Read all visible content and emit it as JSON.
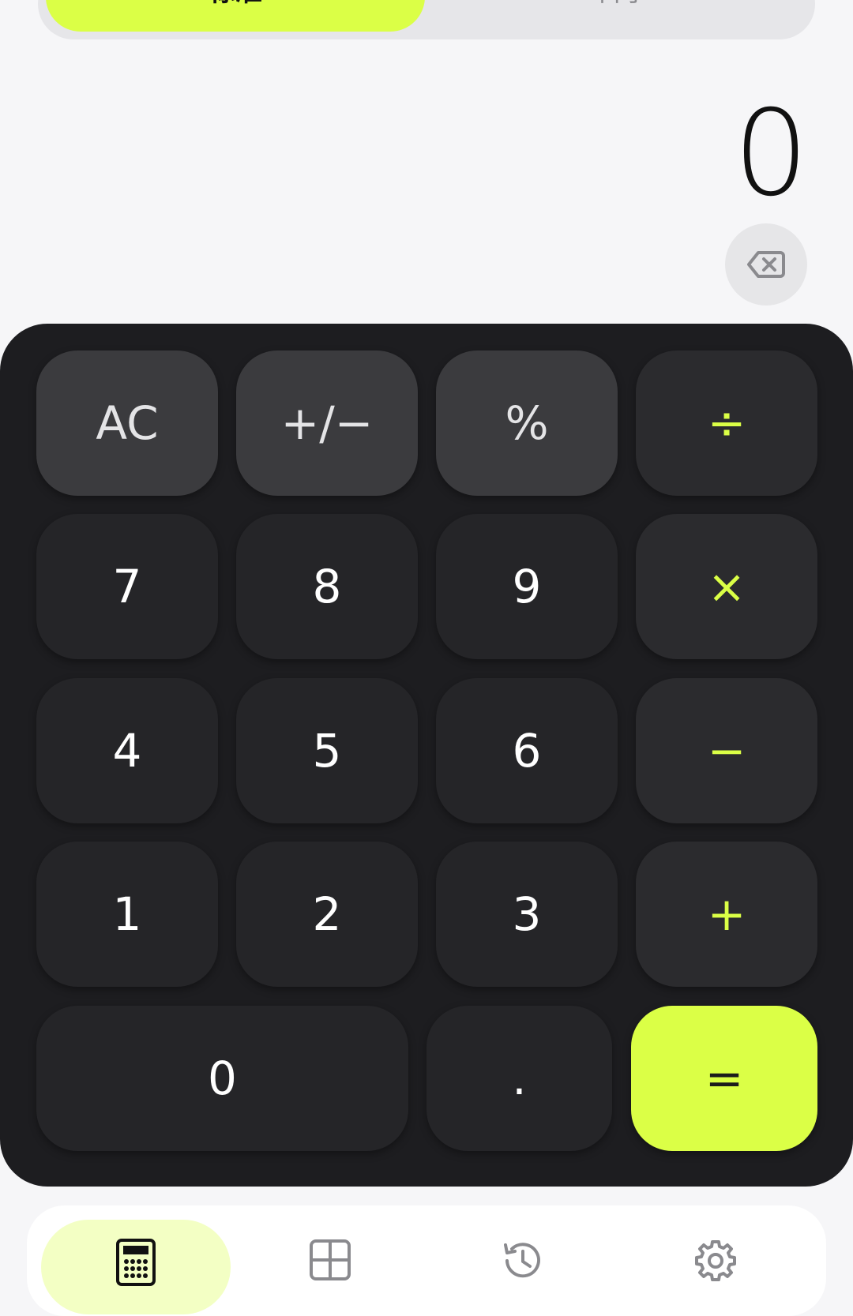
{
  "mode_tabs": {
    "standard": "标准",
    "scientific": "科学"
  },
  "display": {
    "value": "0"
  },
  "keys": {
    "ac": "AC",
    "sign": "+/−",
    "percent": "%",
    "divide": "÷",
    "seven": "7",
    "eight": "8",
    "nine": "9",
    "multiply": "×",
    "four": "4",
    "five": "5",
    "six": "6",
    "minus": "−",
    "one": "1",
    "two": "2",
    "three": "3",
    "plus": "+",
    "zero": "0",
    "dot": ".",
    "equals": "="
  },
  "colors": {
    "accent": "#dbff46",
    "keypad_bg": "#1d1d20",
    "key_bg": "#252528",
    "fn_key_bg": "#3b3b3e",
    "page_bg": "#f6f6f8"
  },
  "icons": {
    "backspace": "backspace-icon",
    "nav": [
      "calculator-icon",
      "grid-icon",
      "history-icon",
      "settings-icon"
    ]
  }
}
